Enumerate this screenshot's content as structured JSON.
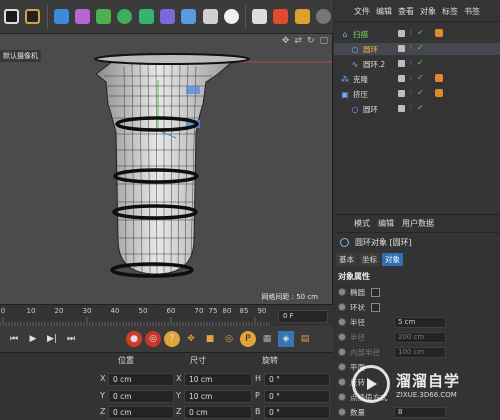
{
  "viewport": {
    "camera_label": "默认摄像机",
    "grid_spacing": "网格间距 : 50 cm"
  },
  "timeline": {
    "ticks": [
      "0",
      "10",
      "20",
      "30",
      "40",
      "50",
      "60",
      "70",
      "75",
      "80",
      "85",
      "90"
    ],
    "frame": "0 F"
  },
  "coordinates": {
    "headers": {
      "position": "位置",
      "size": "尺寸",
      "rotation": "旋转"
    },
    "rows": [
      {
        "pos_axis": "X",
        "pos": "0 cm",
        "size_axis": "X",
        "size": "10 cm",
        "rot_axis": "H",
        "rot": "0 °"
      },
      {
        "pos_axis": "Y",
        "pos": "0 cm",
        "size_axis": "Y",
        "size": "10 cm",
        "rot_axis": "P",
        "rot": "0 °"
      },
      {
        "pos_axis": "Z",
        "pos": "0 cm",
        "size_axis": "Z",
        "size": "0 cm",
        "rot_axis": "B",
        "rot": "0 °"
      }
    ]
  },
  "object_manager": {
    "menu": [
      "文件",
      "编辑",
      "查看",
      "对象",
      "标签",
      "书签"
    ],
    "objects": [
      {
        "name": "扫描",
        "icon": "sweep-icon",
        "indent": 0,
        "selected": false,
        "color": "#7fd36a",
        "tags": true
      },
      {
        "name": "圆环",
        "icon": "circle-spline-icon",
        "indent": 1,
        "selected": true,
        "color": "#ffb040",
        "tags": false
      },
      {
        "name": "圆环.2",
        "icon": "spline-icon",
        "indent": 1,
        "selected": false,
        "color": "#ddd",
        "tags": false
      },
      {
        "name": "克隆",
        "icon": "cloner-icon",
        "indent": 0,
        "selected": false,
        "color": "#ddd",
        "tags": true
      },
      {
        "name": "挤压",
        "icon": "extrude-icon",
        "indent": 0,
        "selected": false,
        "color": "#ddd",
        "tags": true
      },
      {
        "name": "圆环",
        "icon": "circle-spline-icon",
        "indent": 1,
        "selected": false,
        "color": "#ddd",
        "tags": false
      }
    ]
  },
  "attributes": {
    "menu": [
      "模式",
      "编辑",
      "用户数据"
    ],
    "title": "圆环对象 [圆环]",
    "tabs": [
      "基本",
      "坐标",
      "对象"
    ],
    "active_tab": "对象",
    "section": "对象属性",
    "rows": [
      {
        "label": "椭圆",
        "type": "check",
        "value": "",
        "dim": false
      },
      {
        "label": "环状",
        "type": "check",
        "value": "",
        "dim": false
      },
      {
        "label": "半径",
        "type": "field",
        "value": "5 cm",
        "dim": false
      },
      {
        "label": "半径",
        "type": "field",
        "value": "200 cm",
        "dim": true
      },
      {
        "label": "内部半径",
        "type": "field",
        "value": "100 cm",
        "dim": true
      },
      {
        "label": "平面",
        "type": "field",
        "value": "",
        "dim": false
      },
      {
        "label": "反转",
        "type": "field",
        "value": "",
        "dim": false
      },
      {
        "label": "点插值方式",
        "type": "field",
        "value": "",
        "dim": false
      },
      {
        "label": "数量",
        "type": "field",
        "value": "8",
        "dim": false
      }
    ]
  },
  "watermark": {
    "title": "溜溜自学",
    "subtitle": "ZIXUE.3D66.COM"
  }
}
